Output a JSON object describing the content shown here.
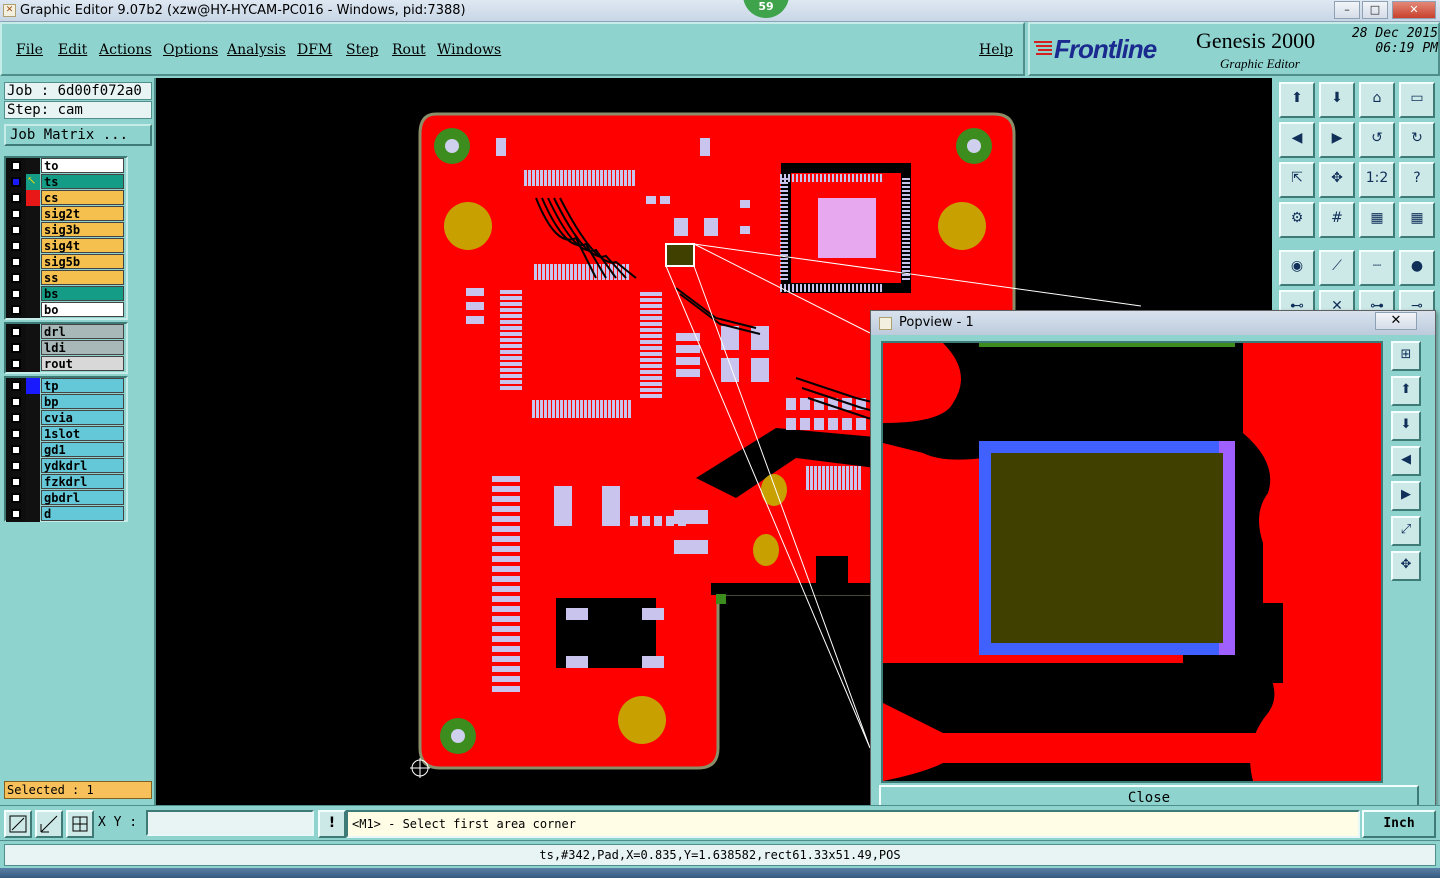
{
  "window": {
    "title": "Graphic Editor 9.07b2 (xzw@HY-HYCAM-PC016 - Windows, pid:7388)",
    "badge": "59",
    "min_label": "–",
    "max_label": "□",
    "close_label": "✕"
  },
  "menu": {
    "file": "File",
    "edit": "Edit",
    "actions": "Actions",
    "options": "Options",
    "analysis": "Analysis",
    "dfm": "DFM",
    "step": "Step",
    "rout": "Rout",
    "windows": "Windows",
    "help": "Help"
  },
  "brand": {
    "logo": "Frontline",
    "product": "Genesis 2000",
    "subtitle": "Graphic Editor",
    "date": "28 Dec 2015",
    "time": "06:19 PM"
  },
  "job": {
    "job": "Job : 6d00f072a0",
    "step": "Step: cam",
    "matrix": "Job Matrix ..."
  },
  "layers_group1": [
    {
      "name": "to",
      "bg": "#ffffff",
      "color": "#111111"
    },
    {
      "name": "ts",
      "bg": "#159c86",
      "color": "#159c86",
      "active": true
    },
    {
      "name": "cs",
      "bg": "#f5c04e",
      "color": "#e81818"
    },
    {
      "name": "sig2t",
      "bg": "#f5c04e",
      "color": "#111111"
    },
    {
      "name": "sig3b",
      "bg": "#f5c04e",
      "color": "#111111"
    },
    {
      "name": "sig4t",
      "bg": "#f5c04e",
      "color": "#111111"
    },
    {
      "name": "sig5b",
      "bg": "#f5c04e",
      "color": "#111111"
    },
    {
      "name": "ss",
      "bg": "#f5c04e",
      "color": "#111111"
    },
    {
      "name": "bs",
      "bg": "#159c86",
      "color": "#111111"
    },
    {
      "name": "bo",
      "bg": "#ffffff",
      "color": "#111111"
    }
  ],
  "layers_group2": [
    {
      "name": "drl",
      "bg": "#a8b8b8",
      "color": "#111111"
    },
    {
      "name": "ldi",
      "bg": "#a8b8b8",
      "color": "#111111"
    },
    {
      "name": "rout",
      "bg": "#d8d8d8",
      "color": "#111111"
    }
  ],
  "layers_group3": [
    {
      "name": "tp",
      "bg": "#64c8d8",
      "color": "#1a1aff"
    },
    {
      "name": "bp",
      "bg": "#64c8d8",
      "color": "#111111"
    },
    {
      "name": "cvia",
      "bg": "#64c8d8",
      "color": "#111111"
    },
    {
      "name": "1slot",
      "bg": "#64c8d8",
      "color": "#111111"
    },
    {
      "name": "gd1",
      "bg": "#64c8d8",
      "color": "#111111"
    },
    {
      "name": "ydkdrl",
      "bg": "#64c8d8",
      "color": "#111111"
    },
    {
      "name": "fzkdrl",
      "bg": "#64c8d8",
      "color": "#111111"
    },
    {
      "name": "gbdrl",
      "bg": "#64c8d8",
      "color": "#111111"
    },
    {
      "name": "d",
      "bg": "#64c8d8",
      "color": "#111111"
    }
  ],
  "selected": "Selected : 1",
  "popview": {
    "title": "Popview - 1",
    "close": "Close",
    "x_label": "✕"
  },
  "bottom": {
    "xy_label": "X Y :",
    "xy_value": "",
    "bang": "!",
    "prompt": "<M1> - Select first area corner",
    "units": "Inch"
  },
  "status": "ts,#342,Pad,X=0.835,Y=1.638582,rect61.33x51.49,POS",
  "colors": {
    "copper": "#ff0000",
    "pad": "#c8c4ee",
    "board_outline": "#8a8f6a",
    "mounting_hole": "#c8a000",
    "fiducial": "#3c8c1e",
    "highlight_fill": "#404000",
    "highlight_border": "#4060ff"
  }
}
